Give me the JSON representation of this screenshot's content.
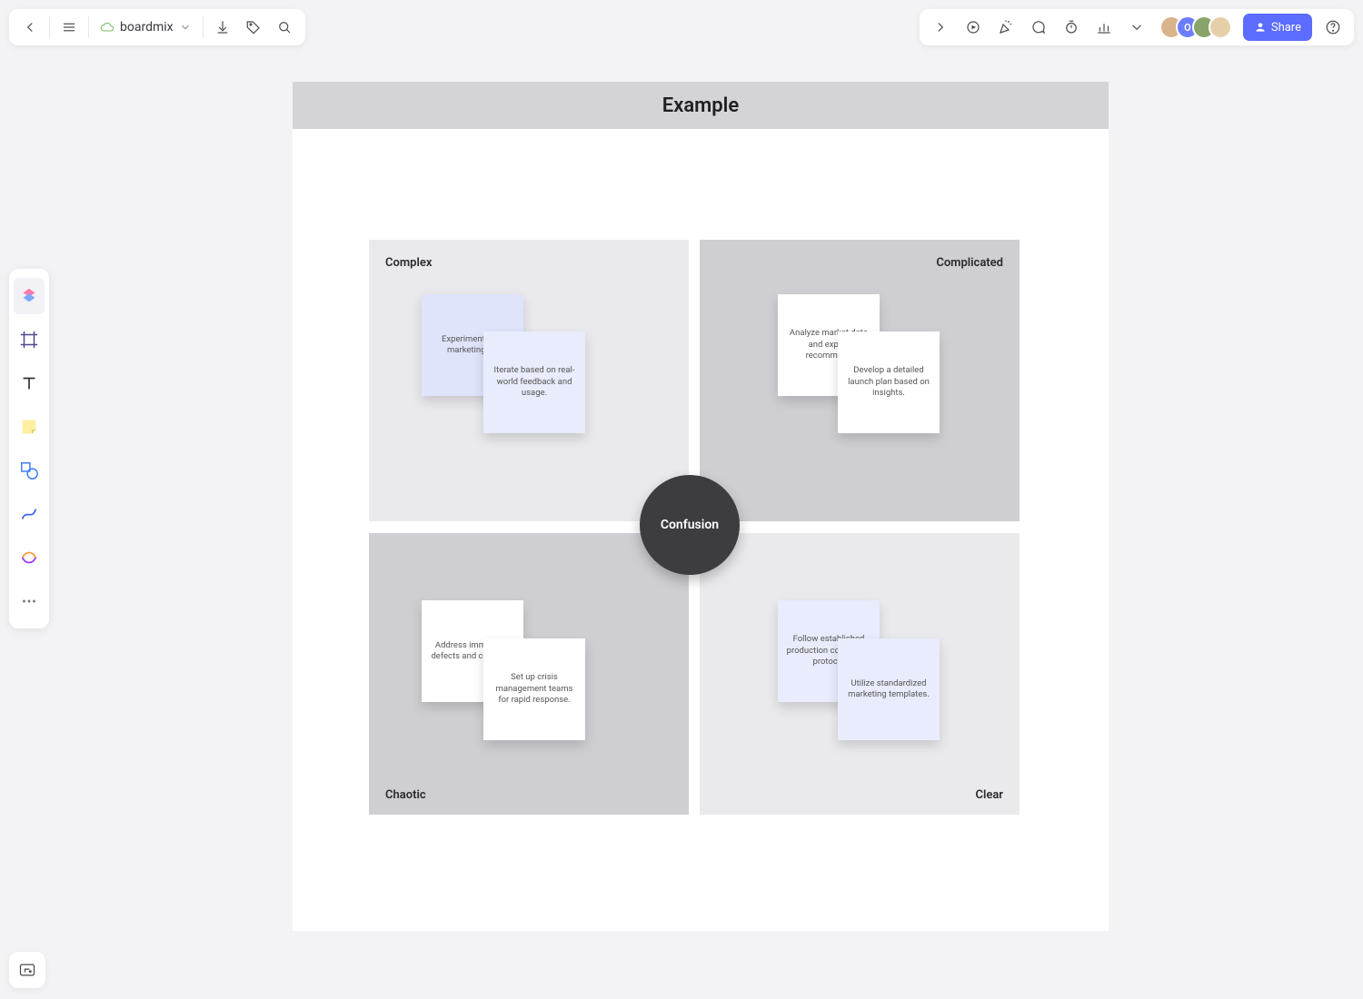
{
  "topLeft": {
    "docName": "boardmix"
  },
  "topRight": {
    "shareLabel": "Share",
    "avatars": [
      {
        "bg": "#d9b38c",
        "initial": ""
      },
      {
        "bg": "#6a7dff",
        "initial": "O"
      },
      {
        "bg": "#8aa36a",
        "initial": ""
      },
      {
        "bg": "#e6cfa8",
        "initial": ""
      }
    ]
  },
  "board": {
    "title": "Example",
    "centerLabel": "Confusion",
    "quadrants": {
      "complex": {
        "label": "Complex",
        "note1": "Experiment with marketing str",
        "note2": "Iterate based on real-world feedback and usage."
      },
      "complicated": {
        "label": "Complicated",
        "note1": "Analyze market data and expert recommend",
        "note2": "Develop a detailed launch plan based on insights."
      },
      "chaotic": {
        "label": "Chaotic",
        "note1": "Address immediate defects and concerns",
        "note2": "Set up crisis management teams for rapid response."
      },
      "clear": {
        "label": "Clear",
        "note1": "Follow established production communic protocol",
        "note2": "Utilize standardized marketing templates."
      }
    }
  }
}
